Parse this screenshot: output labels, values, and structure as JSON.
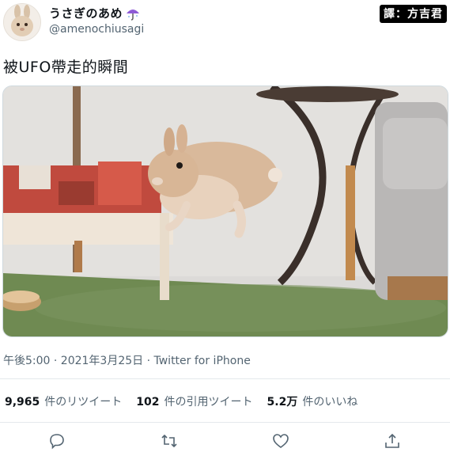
{
  "user": {
    "display_name": "うさぎのあめ",
    "username": "@amenochiusagi",
    "avatar": "rabbit-avatar",
    "emoji_icon": "umbrella-icon"
  },
  "credit": "譯：方吉君",
  "tweet": {
    "text": "被UFO帶走的瞬間",
    "media": "photo of a rabbit leaping in a living room",
    "timestamp": "午後5:00 · 2021年3月25日 · Twitter for iPhone"
  },
  "stats": [
    {
      "value": "9,965",
      "label": "件のリツイート"
    },
    {
      "value": "102",
      "label": "件の引用ツイート"
    },
    {
      "value": "5.2万",
      "label": "件のいいね"
    }
  ],
  "actions": [
    {
      "name": "reply",
      "icon": "reply-icon"
    },
    {
      "name": "retweet",
      "icon": "retweet-icon"
    },
    {
      "name": "like",
      "icon": "heart-icon"
    },
    {
      "name": "share",
      "icon": "share-icon"
    }
  ],
  "colors": {
    "text_primary": "#0f1419",
    "text_secondary": "#536471",
    "divider": "#e4e9ec",
    "umbrella": "#8e5bd6"
  }
}
